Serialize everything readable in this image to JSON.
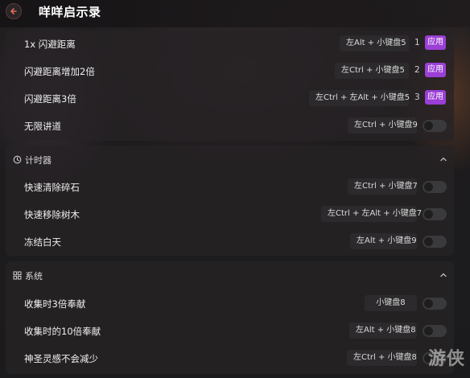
{
  "header": {
    "title": "咩咩启示录"
  },
  "top_rows": [
    {
      "label": "1x 闪避距离",
      "hotkey": "左Alt + 小键盘5",
      "num": "1",
      "apply": "应用"
    },
    {
      "label": "闪避距离增加2倍",
      "hotkey": "左Ctrl + 小键盘5",
      "num": "2",
      "apply": "应用"
    },
    {
      "label": "闪避距离3倍",
      "hotkey": "左Ctrl + 左Alt + 小键盘5",
      "num": "3",
      "apply": "应用"
    },
    {
      "label": "无限讲道",
      "hotkey": "左Ctrl + 小键盘9"
    }
  ],
  "timer": {
    "title": "计时器",
    "rows": [
      {
        "label": "快速清除碎石",
        "hotkey": "左Ctrl + 小键盘7"
      },
      {
        "label": "快速移除树木",
        "hotkey": "左Ctrl + 左Alt + 小键盘7"
      },
      {
        "label": "冻结白天",
        "hotkey": "左Alt + 小键盘9"
      }
    ]
  },
  "system": {
    "title": "系统",
    "rows": [
      {
        "label": "收集时3倍奉献",
        "hotkey": "小键盘8"
      },
      {
        "label": "收集时的10倍奉献",
        "hotkey": "左Alt + 小键盘8"
      },
      {
        "label": "神圣灵感不会减少",
        "hotkey": "左Ctrl + 小键盘8"
      }
    ]
  },
  "watermark": "游侠",
  "colors": {
    "accent": "#9b3fd6",
    "toggle_off": "#3a3a3c",
    "panel": "#262325"
  },
  "icons": {
    "back": "arrow-left-icon",
    "timer": "clock-icon",
    "system": "grid-icon",
    "collapse": "chevron-up-icon"
  }
}
